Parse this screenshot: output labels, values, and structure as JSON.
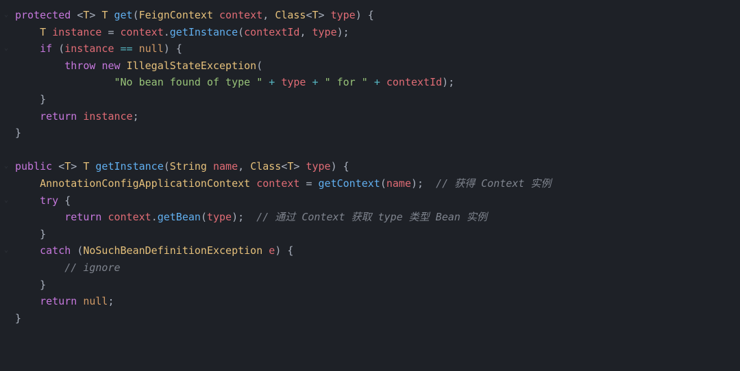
{
  "code": {
    "line1": {
      "kw1": "protected",
      "open": "<",
      "T": "T",
      "close": ">",
      "T2": "T",
      "fn": "get",
      "lp": "(",
      "t1": "FeignContext",
      "p1": "context",
      "c": ",",
      "t2": "Class",
      "lt": "<",
      "T3": "T",
      "gt": ">",
      "p2": "type",
      "rp": ")",
      "lb": "{"
    },
    "line2": {
      "indent": "    ",
      "T": "T",
      "v": "instance",
      "eq": "=",
      "ctx": "context",
      "dot": ".",
      "fn": "getInstance",
      "lp": "(",
      "a1": "contextId",
      "c": ",",
      "a2": "type",
      "rp": ")",
      "sc": ";"
    },
    "line3": {
      "indent": "    ",
      "kw": "if",
      "lp": "(",
      "v": "instance",
      "op": "==",
      "null": "null",
      "rp": ")",
      "lb": "{"
    },
    "line4": {
      "indent": "        ",
      "kw1": "throw",
      "kw2": "new",
      "ex": "IllegalStateException",
      "lp": "("
    },
    "line5": {
      "indent": "                ",
      "s1": "\"No bean found of type \"",
      "p1": "+",
      "v1": "type",
      "p2": "+",
      "s2": "\" for \"",
      "p3": "+",
      "v2": "contextId",
      "rp": ")",
      "sc": ";"
    },
    "line6": {
      "indent": "    ",
      "rb": "}"
    },
    "line7": {
      "indent": "    ",
      "kw": "return",
      "v": "instance",
      "sc": ";"
    },
    "line8": {
      "rb": "}"
    },
    "line10": {
      "kw1": "public",
      "open": "<",
      "T": "T",
      "close": ">",
      "T2": "T",
      "fn": "getInstance",
      "lp": "(",
      "t1": "String",
      "p1": "name",
      "c": ",",
      "t2": "Class",
      "lt": "<",
      "T3": "T",
      "gt": ">",
      "p2": "type",
      "rp": ")",
      "lb": "{"
    },
    "line11": {
      "indent": "    ",
      "t": "AnnotationConfigApplicationContext",
      "v": "context",
      "eq": "=",
      "fn": "getContext",
      "lp": "(",
      "a": "name",
      "rp": ")",
      "sc": ";",
      "cmt": "// 获得 Context 实例"
    },
    "line12": {
      "indent": "    ",
      "kw": "try",
      "lb": "{"
    },
    "line13": {
      "indent": "        ",
      "kw": "return",
      "ctx": "context",
      "dot": ".",
      "fn": "getBean",
      "lp": "(",
      "a": "type",
      "rp": ")",
      "sc": ";",
      "cmt": "// 通过 Context 获取 type 类型 Bean 实例"
    },
    "line14": {
      "indent": "    ",
      "rb": "}"
    },
    "line15": {
      "indent": "    ",
      "kw": "catch",
      "lp": "(",
      "t": "NoSuchBeanDefinitionException",
      "v": "e",
      "rp": ")",
      "lb": "{"
    },
    "line16": {
      "indent": "        ",
      "cmt": "// ignore"
    },
    "line17": {
      "indent": "    ",
      "rb": "}"
    },
    "line18": {
      "indent": "    ",
      "kw": "return",
      "null": "null",
      "sc": ";"
    },
    "line19": {
      "rb": "}"
    }
  }
}
